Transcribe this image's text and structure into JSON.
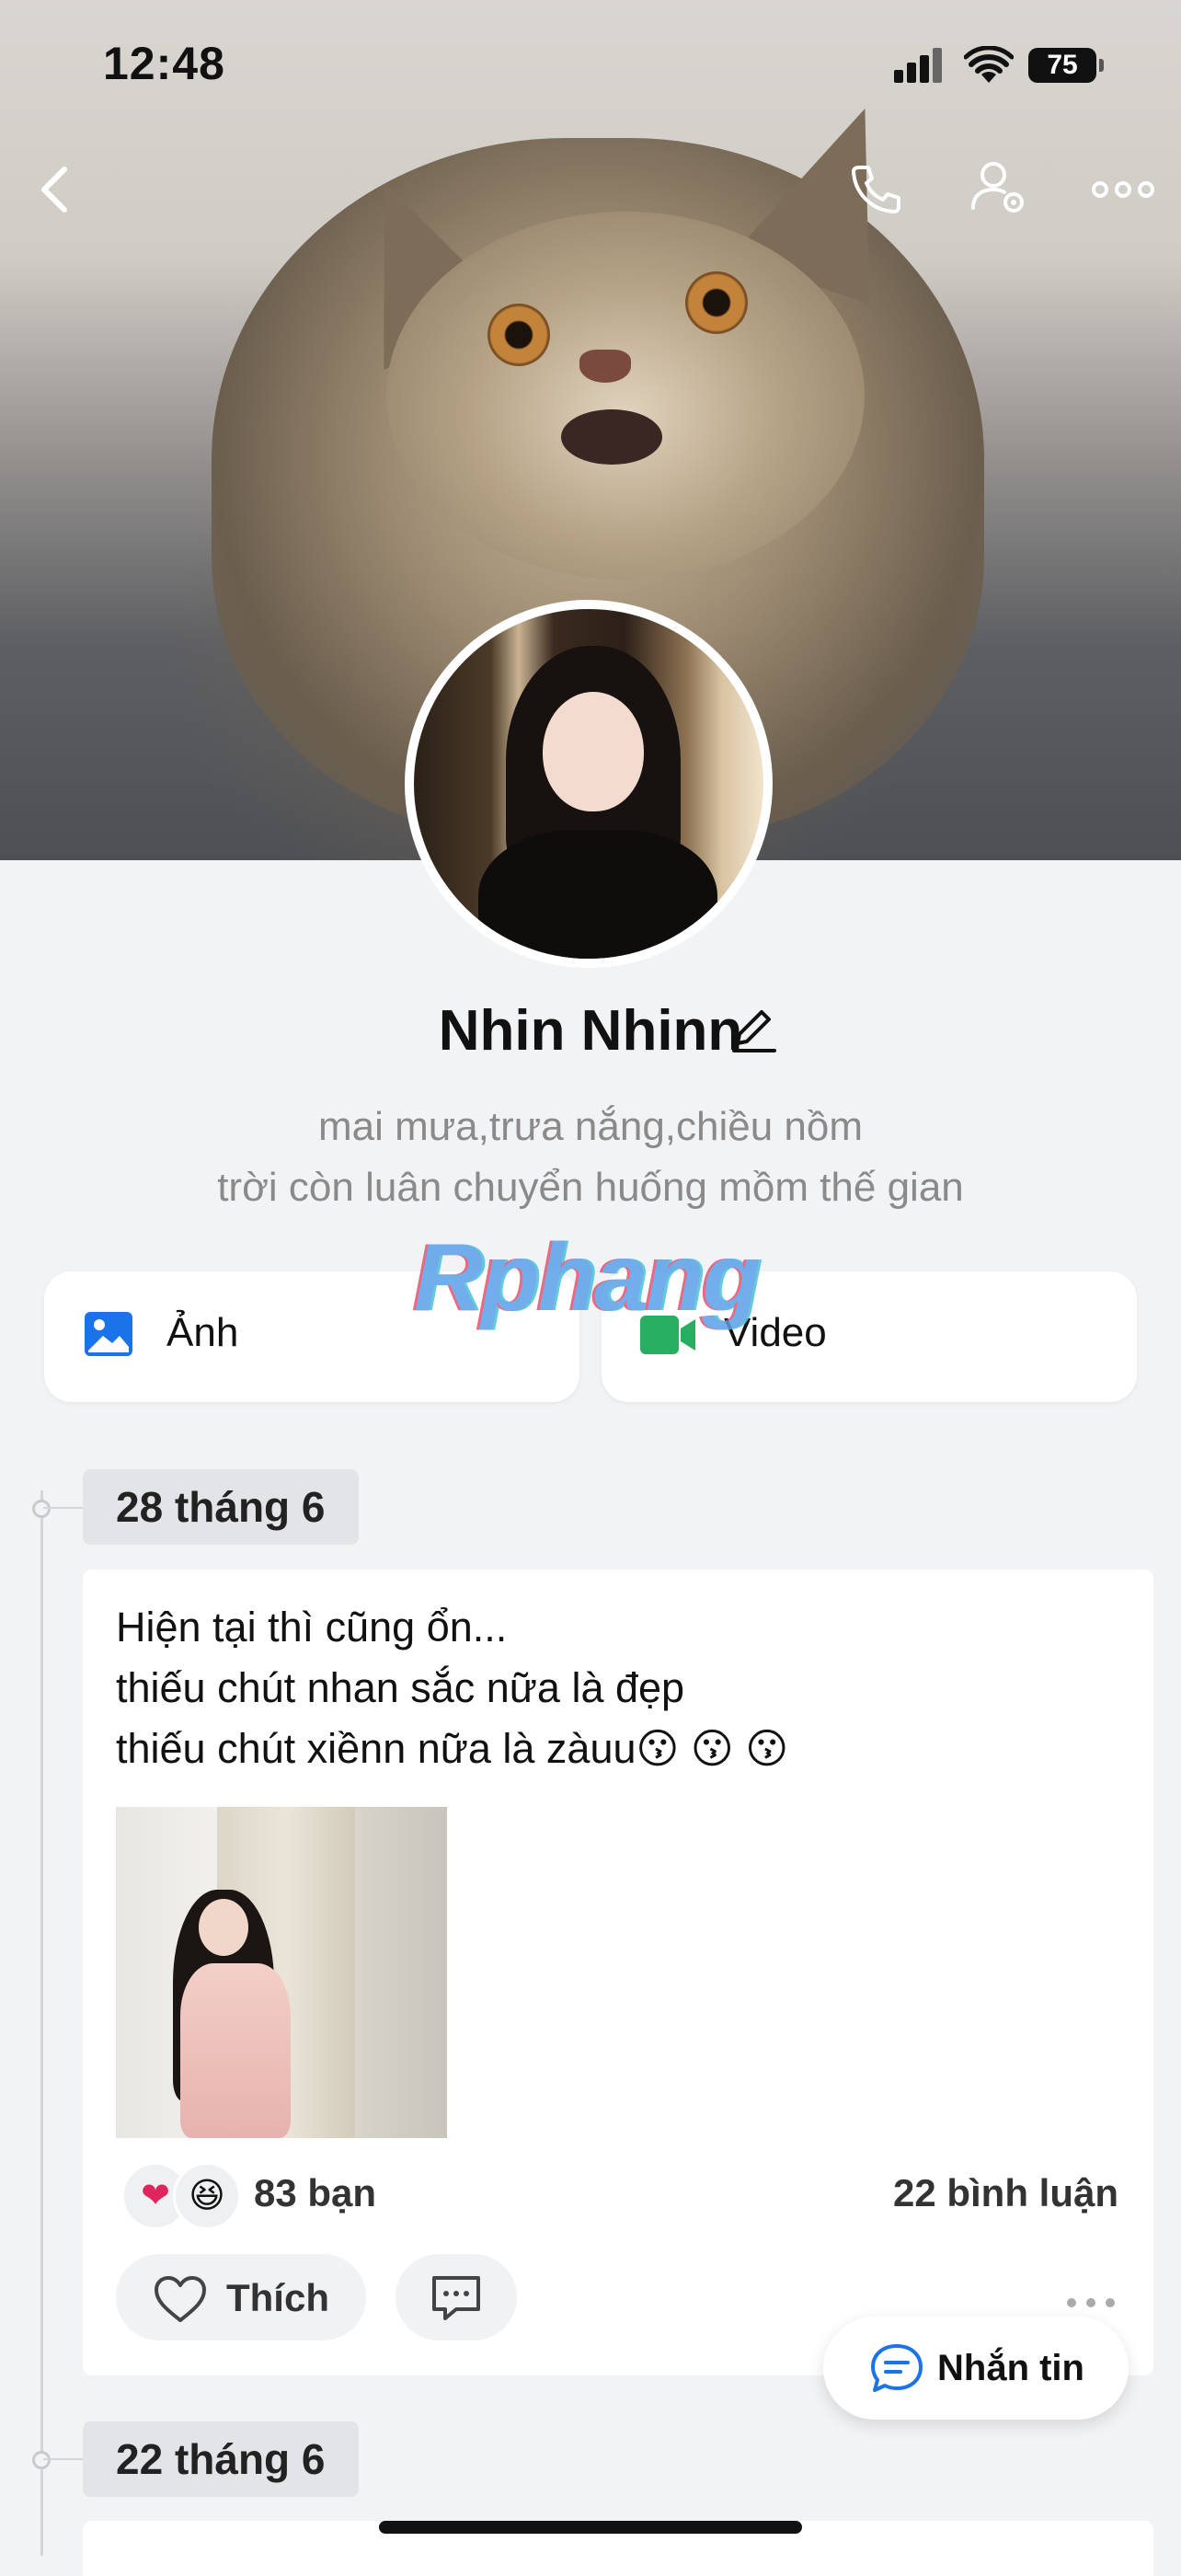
{
  "status_bar": {
    "time": "12:48",
    "battery": "75"
  },
  "profile": {
    "name": "Nhin Nhinn",
    "bio_line1": "mai mưa,trưa nắng,chiều nồm",
    "bio_line2": "trời còn luân chuyển huống mồm thế gian"
  },
  "watermark": "Rphang",
  "media_buttons": {
    "photos_label": "Ảnh",
    "video_label": "Video"
  },
  "timeline": [
    {
      "date": "28 tháng 6",
      "post_lines": [
        "Hiện tại thì cũng ổn...",
        "thiếu chút nhan sắc nữa là đẹp",
        "thiếu chút xiềnn nữa là zàuu😗 😗 😗"
      ],
      "reaction_count": "83 bạn",
      "comment_count": "22 bình luận",
      "like_label": "Thích"
    },
    {
      "date": "22 tháng 6"
    }
  ],
  "message_button": {
    "label": "Nhắn tin"
  },
  "icons": {
    "back": "chevron-left-icon",
    "call": "phone-icon",
    "settings": "user-settings-icon",
    "more": "more-horizontal-icon",
    "photos": "image-icon",
    "video": "video-camera-icon",
    "reaction1": "heart-icon",
    "reaction2": "laughing-emoji-icon",
    "like": "heart-outline-icon",
    "comment": "comment-icon",
    "message": "chat-bubble-icon"
  },
  "colors": {
    "accent_blue": "#1a73e8",
    "video_green": "#27ae60",
    "background": "#f2f3f5"
  }
}
